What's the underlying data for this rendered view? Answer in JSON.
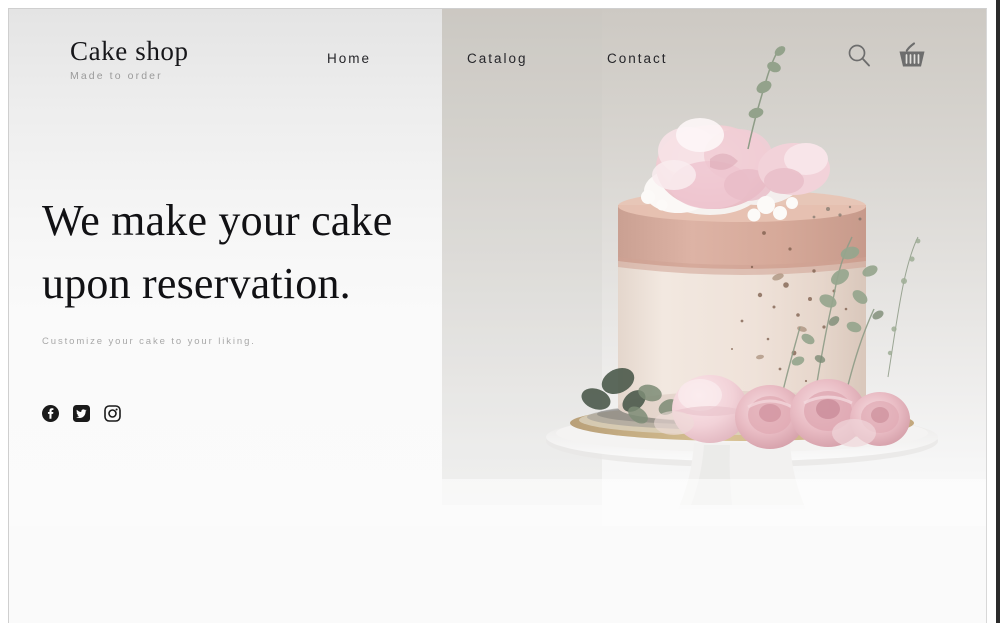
{
  "site": {
    "brand_name": "Cake shop",
    "brand_tagline": "Made to order"
  },
  "nav": {
    "items": [
      {
        "label": "Home",
        "name": "nav-link-home"
      },
      {
        "label": "Catalog",
        "name": "nav-link-catalog"
      },
      {
        "label": "Contact",
        "name": "nav-link-contact"
      }
    ],
    "actions": [
      {
        "icon": "search-icon",
        "label": "Search"
      },
      {
        "icon": "shopping-basket-icon",
        "label": "Cart"
      }
    ]
  },
  "hero": {
    "headline_line1": "We make your cake",
    "headline_line2": "upon reservation.",
    "subtitle": "Customize your cake to your liking.",
    "image_alt": "Pink floral layer cake on a white cake stand"
  },
  "socials": [
    {
      "icon": "facebook-icon",
      "label": "Facebook"
    },
    {
      "icon": "twitter-icon",
      "label": "Twitter"
    },
    {
      "icon": "instagram-icon",
      "label": "Instagram"
    }
  ],
  "colors": {
    "text_dark": "#111114",
    "text_muted": "#a8a8a8",
    "panel_light": "#fafafa",
    "photo_bg": "#cfcbc6",
    "cake_body": "#efe4dc",
    "cake_band": "#d9ab9e",
    "flower_pink": "#f0cdd4",
    "rose_pink": "#e6b3bc",
    "foliage_green": "#9aa893",
    "gold_board": "#cbb183"
  }
}
